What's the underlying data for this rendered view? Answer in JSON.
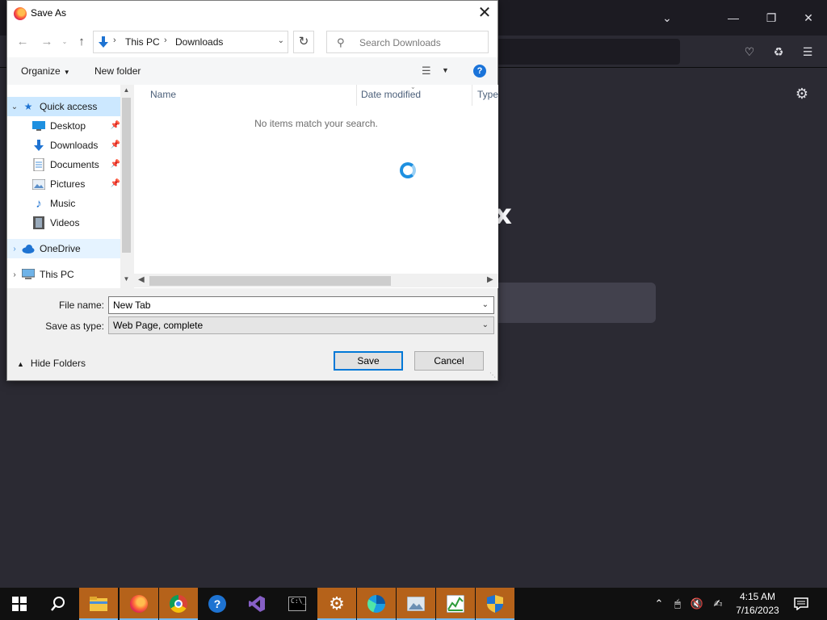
{
  "dialog": {
    "title": "Save As",
    "close_glyph": "✕",
    "address": {
      "crumbs": [
        "This PC",
        "Downloads"
      ],
      "separator": "›"
    },
    "search_placeholder": "Search Downloads",
    "commands": {
      "organize": "Organize",
      "new_folder": "New folder"
    },
    "nav_tree": [
      {
        "label": "Quick access",
        "icon": "star-icon",
        "level": 0,
        "expanded": true,
        "selected": true
      },
      {
        "label": "Desktop",
        "icon": "desktop-icon",
        "level": 1,
        "pinned": true
      },
      {
        "label": "Downloads",
        "icon": "download-arrow-icon",
        "level": 1,
        "pinned": true
      },
      {
        "label": "Documents",
        "icon": "document-icon",
        "level": 1,
        "pinned": true
      },
      {
        "label": "Pictures",
        "icon": "picture-icon",
        "level": 1,
        "pinned": true
      },
      {
        "label": "Music",
        "icon": "music-note-icon",
        "level": 1
      },
      {
        "label": "Videos",
        "icon": "film-icon",
        "level": 1
      },
      {
        "label": "OneDrive",
        "icon": "cloud-icon",
        "level": 0,
        "expanded": false
      },
      {
        "label": "This PC",
        "icon": "computer-icon",
        "level": 0,
        "expanded": false
      }
    ],
    "columns": [
      "Name",
      "Date modified",
      "Type"
    ],
    "empty_message": "No items match your search.",
    "file_name_label": "File name:",
    "file_name_value": "New Tab",
    "save_type_label": "Save as type:",
    "save_type_value": "Web Page, complete",
    "hide_folders": "Hide Folders",
    "save_button": "Save",
    "cancel_button": "Cancel",
    "help_glyph": "?"
  },
  "taskbar": {
    "apps": [
      "start-icon",
      "search-icon",
      "file-explorer-icon",
      "firefox-icon",
      "chrome-icon",
      "help-app-icon",
      "visual-studio-icon",
      "terminal-icon",
      "settings-icon",
      "edge-icon",
      "photo-viewer-icon",
      "task-manager-icon",
      "security-shield-icon"
    ],
    "clock_time": "4:15 AM",
    "clock_date": "7/16/2023"
  },
  "colors": {
    "accent": "#0078d7",
    "selected_row": "#cce8ff",
    "taskbar_active": "#b5621a",
    "firefox_bg": "#2b2a33"
  }
}
